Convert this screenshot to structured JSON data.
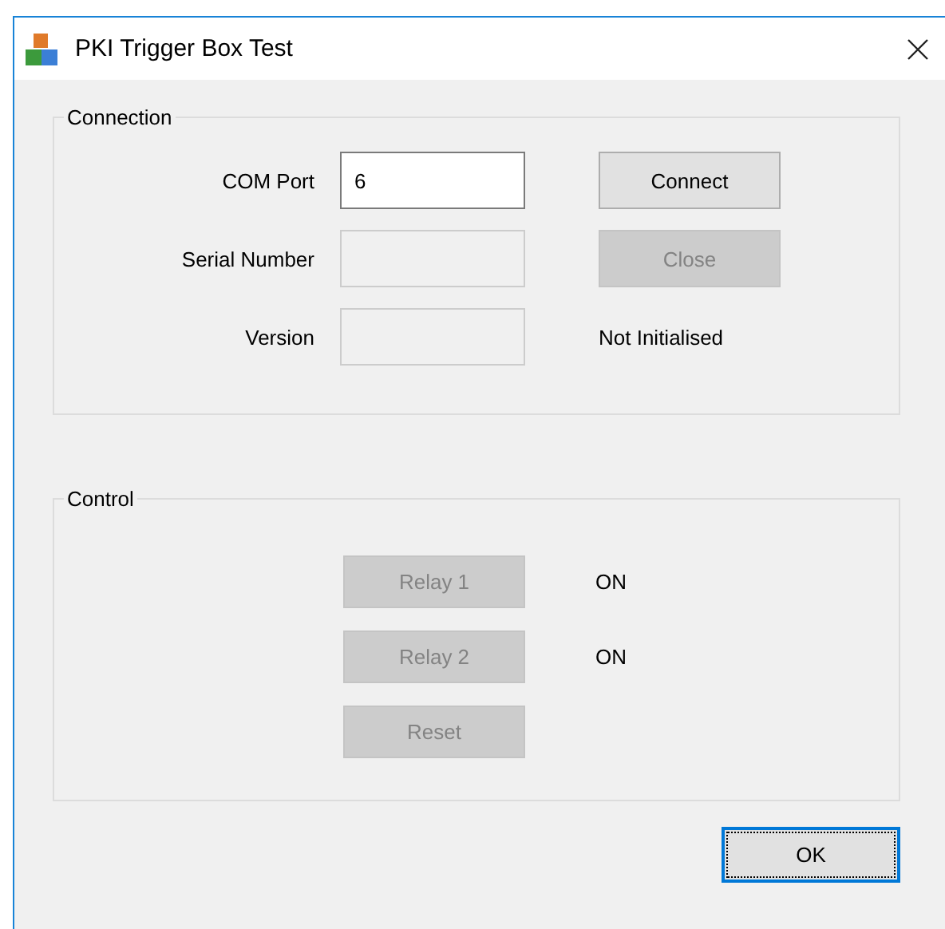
{
  "window": {
    "title": "PKI Trigger Box Test"
  },
  "connection": {
    "title": "Connection",
    "rows": [
      {
        "label": "COM Port",
        "value": "6",
        "disabled": false,
        "side": {
          "kind": "button",
          "label": "Connect",
          "disabled": false
        }
      },
      {
        "label": "Serial Number",
        "value": "",
        "disabled": true,
        "side": {
          "kind": "button",
          "label": "Close",
          "disabled": true
        }
      },
      {
        "label": "Version",
        "value": "",
        "disabled": true,
        "side": {
          "kind": "text",
          "text": "Not Initialised"
        }
      }
    ]
  },
  "control": {
    "title": "Control",
    "rows": [
      {
        "button": {
          "label": "Relay 1",
          "disabled": true
        },
        "state": "ON"
      },
      {
        "button": {
          "label": "Relay 2",
          "disabled": true
        },
        "state": "ON"
      },
      {
        "button": {
          "label": "Reset",
          "disabled": true
        }
      }
    ]
  },
  "buttons": [
    {
      "label": "OK",
      "focused": true
    }
  ]
}
